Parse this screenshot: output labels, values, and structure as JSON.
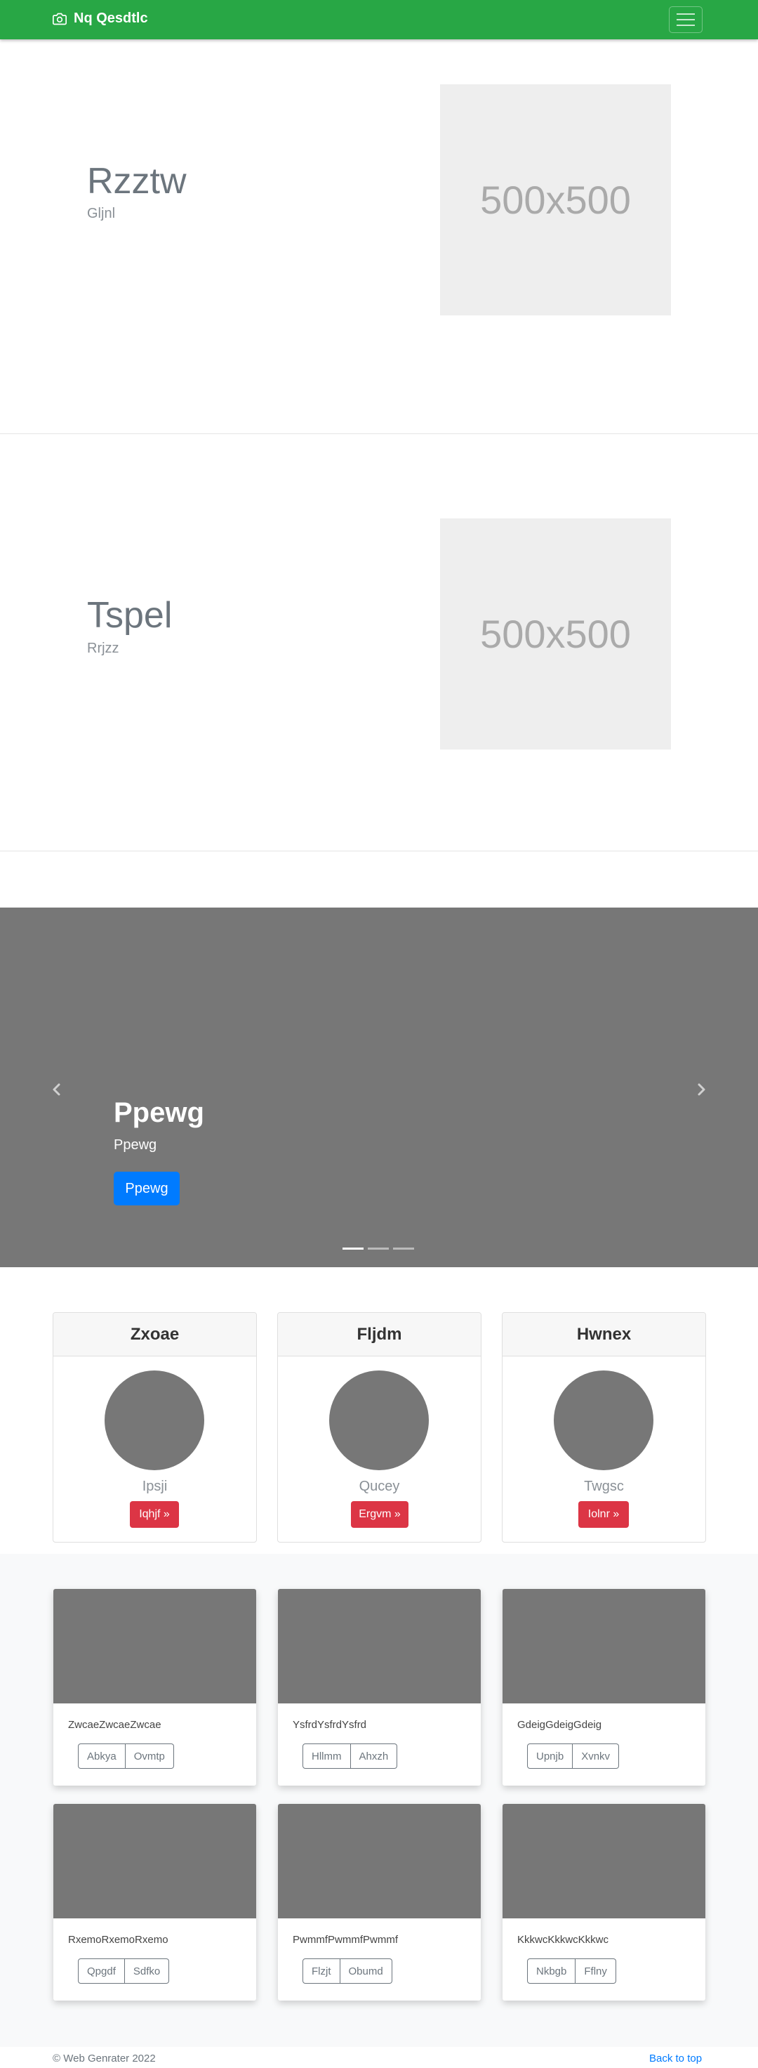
{
  "navbar": {
    "brand": "Nq Qesdtlc",
    "brand_icon": "camera-icon",
    "color": "#28a745"
  },
  "features": [
    {
      "heading": "Rzztw",
      "sub": "Gljnl",
      "image_label": "500x500"
    },
    {
      "heading": "Tspel",
      "sub": "Rrjzz",
      "image_label": "500x500"
    }
  ],
  "carousel": {
    "title": "Ppewg",
    "text": "Ppewg",
    "button": "Ppewg",
    "slides": 3,
    "active_slide": 1
  },
  "pricing": [
    {
      "header": "Zxoae",
      "label": "Ipsji",
      "button": "Iqhjf »"
    },
    {
      "header": "Fljdm",
      "label": "Qucey",
      "button": "Ergvm »"
    },
    {
      "header": "Hwnex",
      "label": "Twgsc",
      "button": "Iolnr »"
    }
  ],
  "album": [
    {
      "text": "ZwcaeZwcaeZwcae",
      "btn1": "Abkya",
      "btn2": "Ovmtp"
    },
    {
      "text": "YsfrdYsfrdYsfrd",
      "btn1": "Hllmm",
      "btn2": "Ahxzh"
    },
    {
      "text": "GdeigGdeigGdeig",
      "btn1": "Upnjb",
      "btn2": "Xvnkv"
    },
    {
      "text": "RxemoRxemoRxemo",
      "btn1": "Qpgdf",
      "btn2": "Sdfko"
    },
    {
      "text": "PwmmfPwmmfPwmmf",
      "btn1": "Flzjt",
      "btn2": "Obumd"
    },
    {
      "text": "KkkwcKkkwcKkkwc",
      "btn1": "Nkbgb",
      "btn2": "Fflny"
    }
  ],
  "footer": {
    "copyright": "© Web Genrater 2022",
    "back_to_top": "Back to top"
  }
}
